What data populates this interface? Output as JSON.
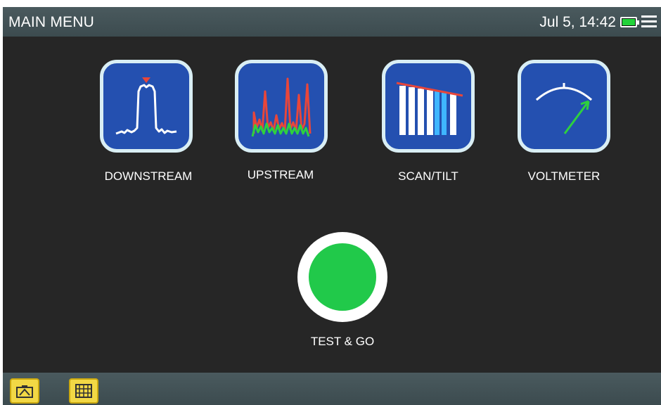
{
  "header": {
    "title": "MAIN MENU",
    "datetime": "Jul 5, 14:42",
    "battery_level": 1.0,
    "icons": [
      "battery-icon",
      "menu-icon"
    ]
  },
  "menu": {
    "items": [
      {
        "label": "DOWNSTREAM",
        "icon": "downstream-spectrum-icon"
      },
      {
        "label": "UPSTREAM",
        "icon": "upstream-spectrum-icon"
      },
      {
        "label": "SCAN/TILT",
        "icon": "scan-tilt-icon"
      },
      {
        "label": "VOLTMETER",
        "icon": "voltmeter-gauge-icon"
      }
    ]
  },
  "test_go": {
    "label": "TEST & GO",
    "color": "#21c94a"
  },
  "footer": {
    "icons": [
      "camera-folder-icon",
      "grid-folder-icon"
    ]
  },
  "colors": {
    "tile_background": "#2450b0",
    "tile_border": "#d9eef4",
    "bar_background": "#44545a",
    "screen_background": "#262626"
  }
}
